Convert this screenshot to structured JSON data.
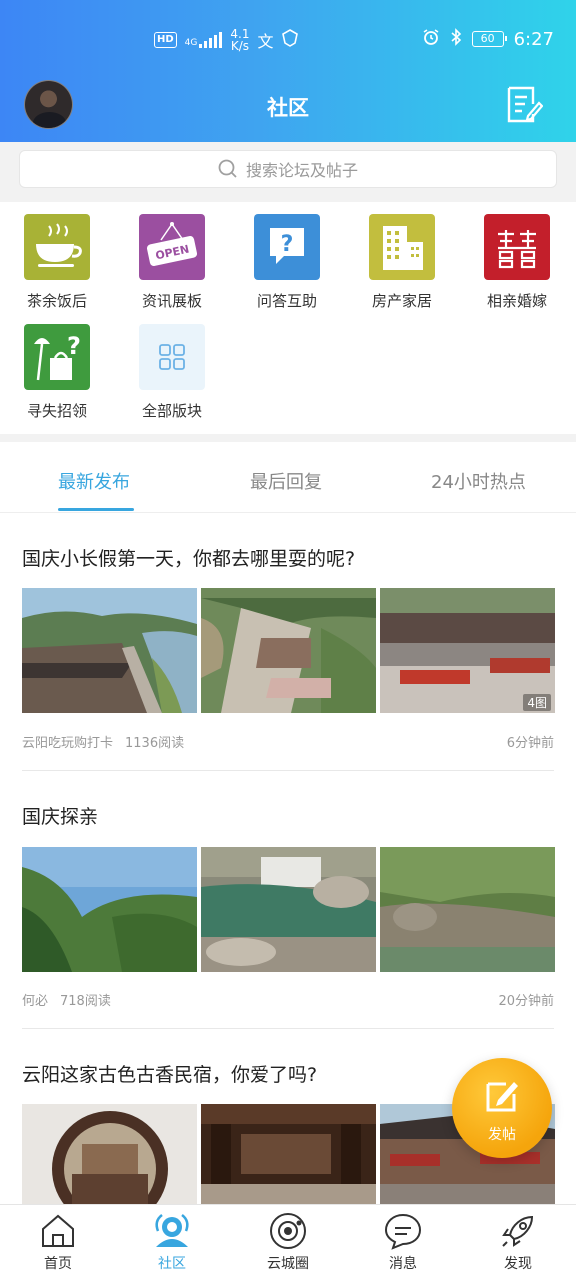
{
  "status_bar": {
    "network_hd": "HD",
    "network_gen": "4G",
    "speed_value": "4.1",
    "speed_unit": "K/s",
    "battery": "60",
    "time": "6:27"
  },
  "header": {
    "title": "社区"
  },
  "search": {
    "placeholder": "搜索论坛及帖子"
  },
  "categories": [
    {
      "label": "茶余饭后",
      "icon": "tea-cup-icon",
      "color": "#a8b236"
    },
    {
      "label": "资讯展板",
      "icon": "open-sign-icon",
      "color": "#9b4fa0"
    },
    {
      "label": "问答互助",
      "icon": "question-bubble-icon",
      "color": "#3d8fd8"
    },
    {
      "label": "房产家居",
      "icon": "building-icon",
      "color": "#c2be3e"
    },
    {
      "label": "相亲婚嫁",
      "icon": "double-happiness-icon",
      "color": "#c31f2b"
    },
    {
      "label": "寻失招领",
      "icon": "lost-found-icon",
      "color": "#3f9b3e"
    },
    {
      "label": "全部版块",
      "icon": "grid-icon",
      "color": "#eaf4fb"
    }
  ],
  "tabs": [
    {
      "label": "最新发布",
      "active": true
    },
    {
      "label": "最后回复",
      "active": false
    },
    {
      "label": "24小时热点",
      "active": false
    }
  ],
  "posts": [
    {
      "title": "国庆小长假第一天，你都去哪里耍的呢?",
      "author": "云阳吃玩购打卡",
      "reads": "1136阅读",
      "time_ago": "6分钟前",
      "image_count": "4图"
    },
    {
      "title": "国庆探亲",
      "author": "何必",
      "reads": "718阅读",
      "time_ago": "20分钟前"
    },
    {
      "title": "云阳这家古色古香民宿，你爱了吗?"
    }
  ],
  "fab": {
    "label": "发帖"
  },
  "bottom_nav": [
    {
      "label": "首页",
      "icon": "home-icon",
      "active": false
    },
    {
      "label": "社区",
      "icon": "community-icon",
      "active": true
    },
    {
      "label": "云城圈",
      "icon": "planet-icon",
      "active": false
    },
    {
      "label": "消息",
      "icon": "message-icon",
      "active": false
    },
    {
      "label": "发现",
      "icon": "rocket-icon",
      "active": false
    }
  ],
  "colors": {
    "accent": "#38a6df",
    "header_start": "#3d86f5",
    "header_end": "#2fd3ea",
    "fab": "#f5a50c"
  }
}
